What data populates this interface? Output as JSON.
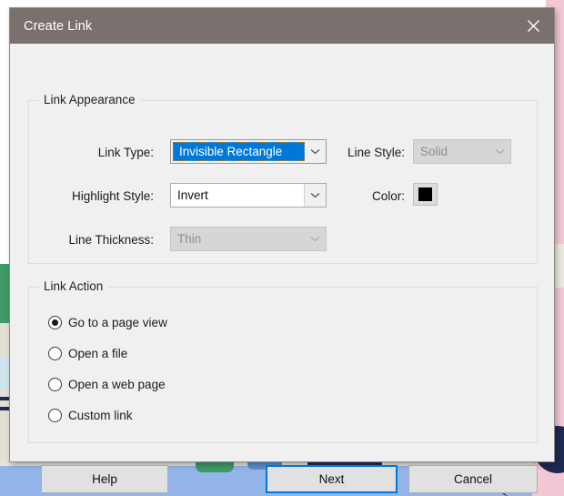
{
  "window": {
    "title": "Create Link",
    "close_icon": "close-icon"
  },
  "appearance": {
    "group_title": "Link Appearance",
    "link_type": {
      "label": "Link Type:",
      "value": "Invisible Rectangle",
      "state": "selected"
    },
    "line_style": {
      "label": "Line Style:",
      "value": "Solid",
      "state": "disabled"
    },
    "highlight_style": {
      "label": "Highlight Style:",
      "value": "Invert",
      "state": "enabled"
    },
    "color": {
      "label": "Color:",
      "value": "#000000"
    },
    "line_thickness": {
      "label": "Line Thickness:",
      "value": "Thin",
      "state": "disabled"
    }
  },
  "action": {
    "group_title": "Link Action",
    "options": [
      {
        "label": "Go to a page view",
        "checked": true
      },
      {
        "label": "Open a file",
        "checked": false
      },
      {
        "label": "Open a web page",
        "checked": false
      },
      {
        "label": "Custom link",
        "checked": false
      }
    ]
  },
  "footer": {
    "help": "Help",
    "next": "Next",
    "cancel": "Cancel"
  },
  "colors": {
    "accent": "#0078d7",
    "titlebar": "#7a716e",
    "dialog_bg": "#f0f0f0",
    "backdrop": "#f4c7d4"
  }
}
